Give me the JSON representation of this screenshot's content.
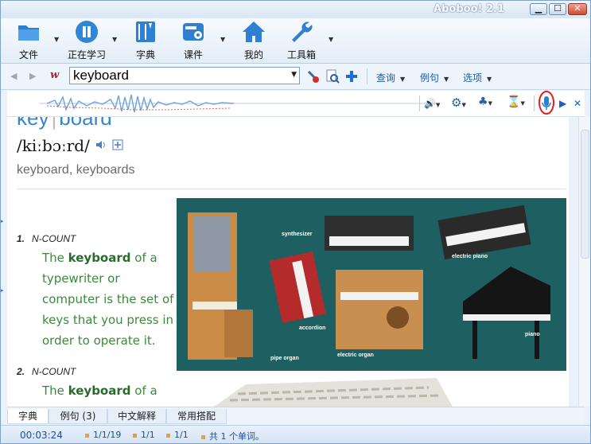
{
  "window": {
    "title": "Aboboo! 2.1"
  },
  "ribbon": {
    "file": "文件",
    "studying": "正在学习",
    "dictionary": "字典",
    "courseware": "课件",
    "mine": "我的",
    "toolbox": "工具箱"
  },
  "toolbar": {
    "search_value": "keyboard",
    "menu_query": "查询",
    "menu_examples": "例句",
    "menu_options": "选项"
  },
  "entry": {
    "headword_a": "key",
    "headword_b": "board",
    "phonetic": "/kiːbɔːrd/",
    "forms": "keyboard, keyboards",
    "senses": [
      {
        "num": "1.",
        "pos": "N-COUNT",
        "def_pre": "The ",
        "def_bold": "keyboard",
        "def_post": " of a typewriter or computer is the set of keys that you press in order to operate it."
      },
      {
        "num": "2.",
        "pos": "N-COUNT",
        "def_pre": "The ",
        "def_bold": "keyboard",
        "def_post": " of a"
      }
    ],
    "picture_captions": {
      "synthesizer": "synthesizer",
      "electric_piano": "electric piano",
      "accordion": "accordion",
      "pipe_organ": "pipe organ",
      "electric_organ": "electric organ",
      "piano": "piano"
    }
  },
  "tabs": [
    "字典",
    "例句 (3)",
    "中文解释",
    "常用搭配"
  ],
  "status": {
    "time": "00:03:24",
    "pos1": "1/1/19",
    "pos2": "1/1",
    "pos3": "1/1",
    "total": "共 1 个单词。"
  },
  "colors": {
    "accent": "#2a6fc0",
    "definition": "#3a8a3a",
    "headword": "#3a85c8",
    "record_highlight": "#e02020"
  }
}
